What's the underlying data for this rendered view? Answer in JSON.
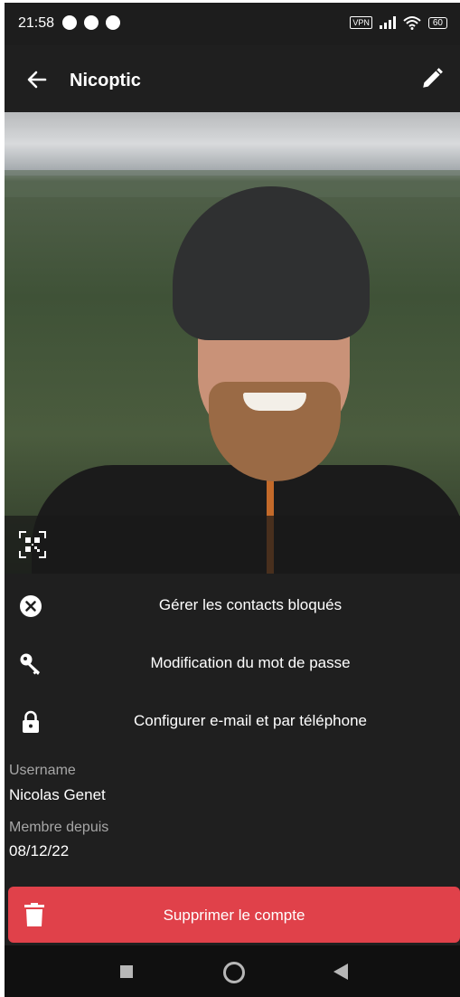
{
  "status_bar": {
    "time": "21:58",
    "vpn": "VPN",
    "battery": "60"
  },
  "app_bar": {
    "title": "Nicoptic",
    "back_icon": "arrow-left-icon",
    "edit_icon": "pencil-icon"
  },
  "profile": {
    "qr_icon": "qr-code-icon"
  },
  "menu": [
    {
      "label": "Gérer les contacts bloqués",
      "icon": "close-circle-icon"
    },
    {
      "label": "Modification du mot de passe",
      "icon": "key-icon"
    },
    {
      "label": "Configurer e-mail et par téléphone",
      "icon": "lock-icon"
    }
  ],
  "info": {
    "username_label": "Username",
    "username_value": "Nicolas Genet",
    "member_since_label": "Membre depuis",
    "member_since_value": "08/12/22"
  },
  "delete_account": {
    "label": "Supprimer le compte",
    "icon": "trash-icon",
    "color": "#e0414a"
  },
  "nav_bar": {
    "icons": [
      "recents-square-icon",
      "home-circle-icon",
      "back-triangle-icon"
    ]
  }
}
